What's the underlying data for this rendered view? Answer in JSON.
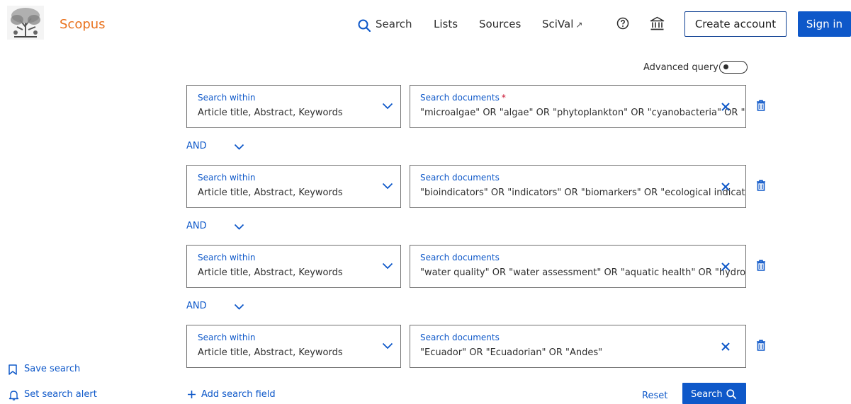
{
  "header": {
    "brand": "Scopus",
    "nav": {
      "search": "Search",
      "lists": "Lists",
      "sources": "Sources",
      "scival": "SciVal",
      "scival_arrow": "↗"
    },
    "create_account": "Create account",
    "sign_in": "Sign in"
  },
  "advanced_query_label": "Advanced query",
  "search_rows": [
    {
      "within_label": "Search within",
      "within_value": "Article title, Abstract, Keywords",
      "doc_label": "Search documents",
      "required": "*",
      "doc_value": "\"microalgae\" OR \"algae\" OR \"phytoplankton\" OR \"cyanobacteria\" OR \"diatoms\""
    },
    {
      "within_label": "Search within",
      "within_value": "Article title, Abstract, Keywords",
      "doc_label": "Search documents",
      "doc_value": "\"bioindicators\" OR \"indicators\" OR \"biomarkers\" OR \"ecological indicators\""
    },
    {
      "within_label": "Search within",
      "within_value": "Article title, Abstract, Keywords",
      "doc_label": "Search documents",
      "doc_value": "\"water quality\" OR \"water assessment\" OR \"aquatic health\" OR \"hydrological\""
    },
    {
      "within_label": "Search within",
      "within_value": "Article title, Abstract, Keywords",
      "doc_label": "Search documents",
      "doc_value": "\"Ecuador\" OR \"Ecuadorian\" OR \"Andes\""
    }
  ],
  "operators": [
    "AND",
    "AND",
    "AND"
  ],
  "sidebar": {
    "save_search": "Save search",
    "set_alert": "Set search alert"
  },
  "footer": {
    "add_field": "Add search field",
    "reset": "Reset",
    "search": "Search"
  },
  "colors": {
    "accent": "#0e58c9",
    "brand": "#e9711c",
    "required": "#c8102e"
  },
  "icons": [
    "elsevier-tree-logo",
    "search-icon",
    "help-icon",
    "institution-icon",
    "chevron-down-icon",
    "close-icon",
    "trash-icon",
    "bookmark-icon",
    "bell-icon",
    "plus-icon"
  ]
}
